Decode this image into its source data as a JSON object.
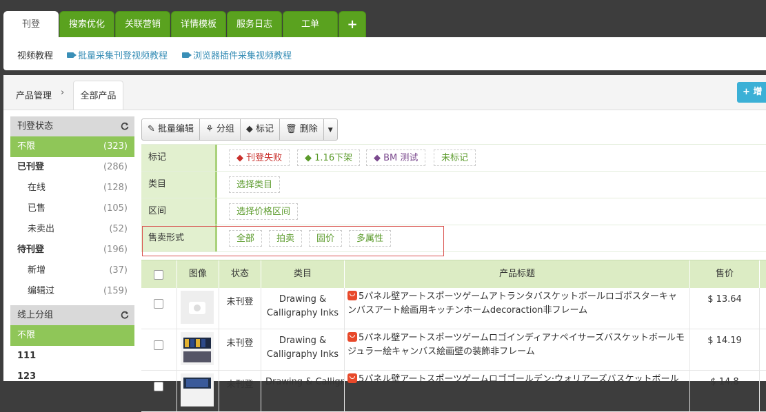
{
  "tabs": [
    {
      "label": "刊登",
      "active": true
    },
    {
      "label": "搜索优化"
    },
    {
      "label": "关联营销"
    },
    {
      "label": "详情模板"
    },
    {
      "label": "服务日志"
    },
    {
      "label": "工单"
    },
    {
      "label": "+"
    }
  ],
  "subnav": {
    "label": "视频教程",
    "links": [
      "批量采集刊登视频教程",
      "浏览器插件采集视频教程"
    ]
  },
  "breadcrumb": {
    "parent": "产品管理",
    "current": "全部产品"
  },
  "add_button": "增",
  "sidebar": {
    "groups": [
      {
        "title": "刊登状态",
        "icon": "refresh-icon",
        "items": [
          {
            "label": "不限",
            "count": "(323)",
            "selected": true
          },
          {
            "label": "已刊登",
            "count": "(286)",
            "bold": true
          },
          {
            "label": "在线",
            "count": "(128)",
            "indent": true
          },
          {
            "label": "已售",
            "count": "(105)",
            "indent": true
          },
          {
            "label": "未卖出",
            "count": "(52)",
            "indent": true
          },
          {
            "label": "待刊登",
            "count": "(196)",
            "bold": true
          },
          {
            "label": "新增",
            "count": "(37)",
            "indent": true
          },
          {
            "label": "编辑过",
            "count": "(159)",
            "indent": true
          }
        ]
      },
      {
        "title": "线上分组",
        "icon": "refresh-icon",
        "items": [
          {
            "label": "不限",
            "selected": true
          },
          {
            "label": "111",
            "bold": true
          },
          {
            "label": "123",
            "bold": true
          }
        ]
      }
    ]
  },
  "toolbar": {
    "batch_edit": "批量编辑",
    "group": "分组",
    "mark": "标记",
    "delete": "删除"
  },
  "filters": {
    "mark": {
      "label": "标记",
      "tags": [
        "刊登失败",
        "1.16下架",
        "BM 测试",
        "未标记"
      ]
    },
    "category": {
      "label": "类目",
      "tags": [
        "选择类目"
      ]
    },
    "range": {
      "label": "区间",
      "tags": [
        "选择价格区间"
      ]
    },
    "sale_type": {
      "label": "售卖形式",
      "tags": [
        "全部",
        "拍卖",
        "固价",
        "多属性"
      ]
    }
  },
  "colors": {
    "tag_red": "#c9302c",
    "tag_green": "#5a9a2a",
    "tag_purple": "#7b4a8e",
    "accent": "#5aa21f"
  },
  "table": {
    "headers": {
      "image": "图像",
      "status": "状态",
      "category": "类目",
      "title": "产品标题",
      "price": "售价"
    },
    "rows": [
      {
        "status": "未刊登",
        "category": "Drawing & Calligraphy Inks",
        "title": "5パネル壁アートスポーツゲームアトランタバスケットボールロゴポスターキャンバスアート絵画用キッチンホームdecoraction非フレーム",
        "price": "$ 13.64",
        "placeholder": true
      },
      {
        "status": "未刊登",
        "category": "Drawing & Calligraphy Inks",
        "title": "5パネル壁アートスポーツゲームロゴインディアナペイサーズバスケットボールモジュラー絵キャンバス絵画壁の装飾非フレーム",
        "price": "$ 14.19"
      },
      {
        "status": "未刊登",
        "category": "Drawing & Calligr",
        "title": "5パネル壁アートスポーツゲームロゴゴールデン·ウォリアーズバスケットボール",
        "price": "$ 14.8"
      }
    ]
  }
}
